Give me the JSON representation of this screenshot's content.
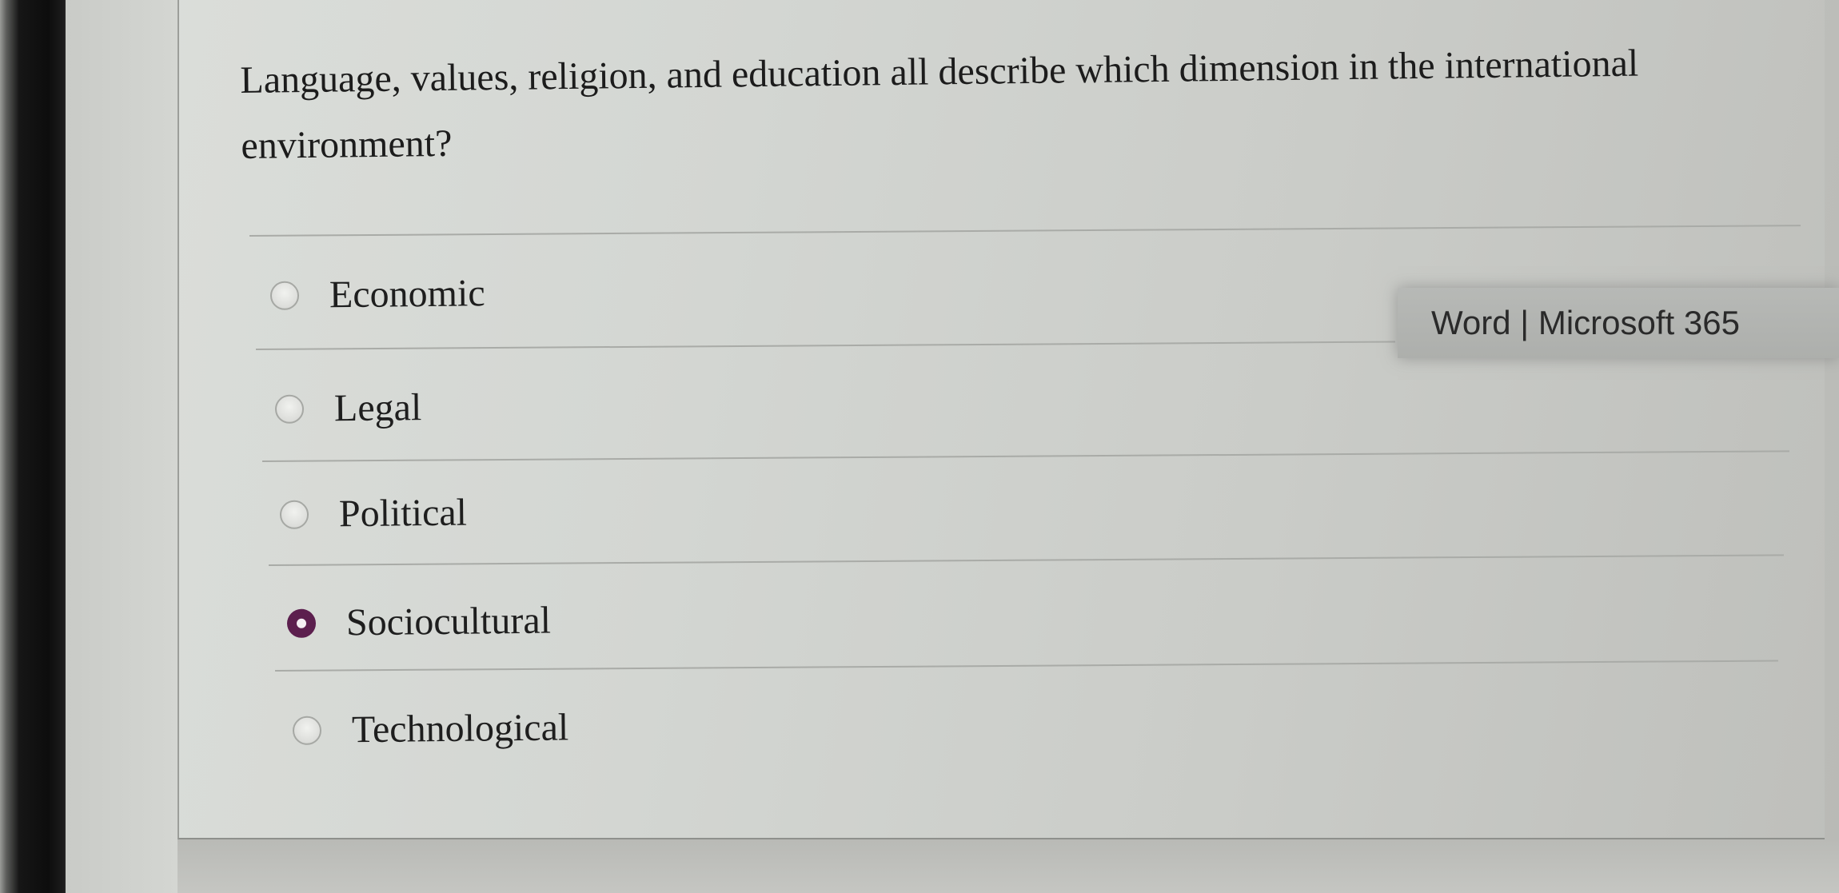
{
  "question": {
    "text": "Language, values, religion, and education all describe which dimension in the international environment?"
  },
  "options": [
    {
      "label": "Economic",
      "selected": false
    },
    {
      "label": "Legal",
      "selected": false
    },
    {
      "label": "Political",
      "selected": false
    },
    {
      "label": "Sociocultural",
      "selected": true
    },
    {
      "label": "Technological",
      "selected": false
    }
  ],
  "tooltip": {
    "text": "Word | Microsoft 365"
  },
  "colors": {
    "selected_radio": "#5c1f4e",
    "text": "#1e1e1e"
  }
}
